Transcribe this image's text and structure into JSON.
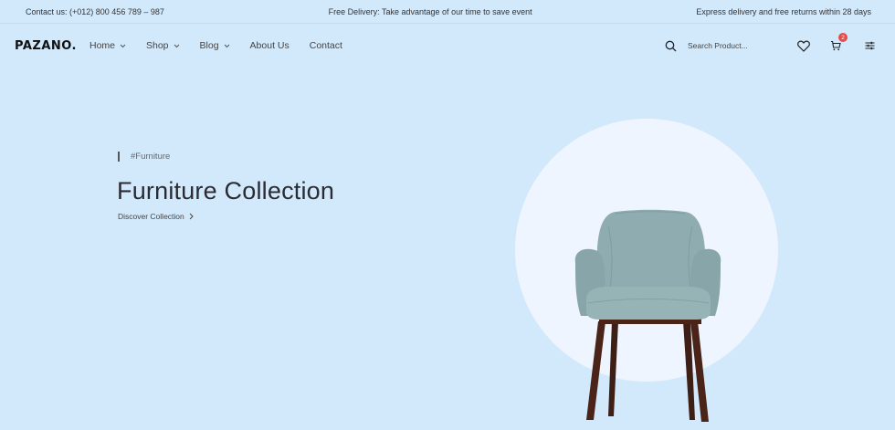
{
  "topbar": {
    "contact": "Contact us: (+012) 800 456 789 – 987",
    "promo": "Free Delivery: Take advantage of our time to save event",
    "shipping": "Express delivery and free returns within 28 days"
  },
  "header": {
    "logo": "PAZANO",
    "menu": [
      {
        "label": "Home",
        "dropdown": true
      },
      {
        "label": "Shop",
        "dropdown": true
      },
      {
        "label": "Blog",
        "dropdown": true
      },
      {
        "label": "About Us",
        "dropdown": false
      },
      {
        "label": "Contact",
        "dropdown": false
      }
    ],
    "search": {
      "placeholder": "Search Product...",
      "value": ""
    },
    "cart_count": "2",
    "icons": [
      "search-icon",
      "heart-icon",
      "cart-icon",
      "filter-icon"
    ]
  },
  "hero": {
    "tag": "#Furniture",
    "title": "Furniture Collection",
    "link_label": "Discover Collection",
    "image": "chair-image"
  },
  "colors": {
    "background": "#d2e9fc",
    "circle": "#eef5ff",
    "badge": "#e44b4b",
    "chair_fabric": "#8fadb0",
    "chair_legs": "#4a2418"
  }
}
